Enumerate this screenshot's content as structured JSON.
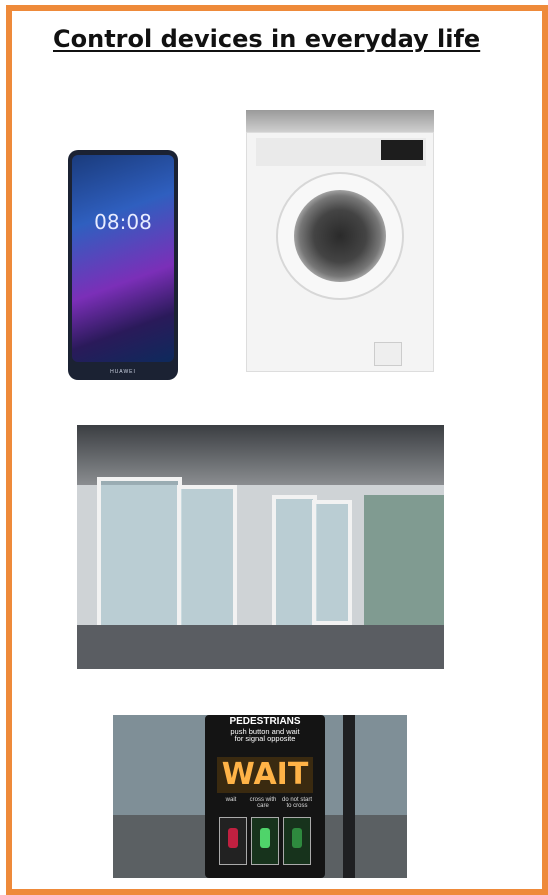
{
  "title": "Control devices in everyday life",
  "images": [
    {
      "name": "smartphone",
      "caption": ""
    },
    {
      "name": "washing-machine",
      "caption": ""
    },
    {
      "name": "automatic-doors",
      "caption": ""
    },
    {
      "name": "pedestrian-crossing-button",
      "caption": ""
    }
  ],
  "phone": {
    "clock": "08:08",
    "brand": "HUAWEI"
  },
  "crossing": {
    "header": "PEDESTRIANS",
    "line1": "push button and wait",
    "line2": "for signal opposite",
    "wait": "WAIT",
    "cap_wait": "wait",
    "cap_cross": "cross with care",
    "cap_dont": "do not start to cross"
  },
  "colors": {
    "border": "#ee8a3a",
    "wait_amber": "#ffb347"
  }
}
